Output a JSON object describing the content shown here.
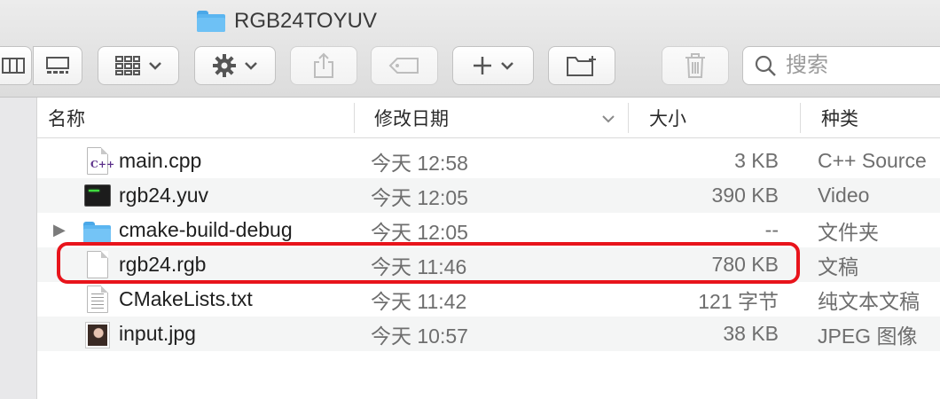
{
  "window": {
    "title": "RGB24TOYUV",
    "folder_icon": "folder-icon"
  },
  "toolbar": {
    "view_list_icon": "list-view-icon",
    "view_gallery_icon": "gallery-view-icon",
    "group_icon": "grid-group-icon",
    "action_icon": "gear-icon",
    "share_icon": "share-icon",
    "tag_icon": "tag-icon",
    "new_icon": "plus-icon",
    "new_folder_icon": "new-folder-icon",
    "trash_icon": "trash-icon",
    "chevron": "⌄"
  },
  "search": {
    "placeholder": "搜索",
    "value": ""
  },
  "columns": {
    "name": "名称",
    "date": "修改日期",
    "size": "大小",
    "kind": "种类"
  },
  "files": [
    {
      "name": "main.cpp",
      "date": "今天 12:58",
      "size": "3 KB",
      "kind": "C++ Source",
      "icon": "cpp-file-icon",
      "disclosure": ""
    },
    {
      "name": "rgb24.yuv",
      "date": "今天 12:05",
      "size": "390 KB",
      "kind": "Video",
      "icon": "terminal-file-icon",
      "disclosure": ""
    },
    {
      "name": "cmake-build-debug",
      "date": "今天 12:05",
      "size": "--",
      "kind": "文件夹",
      "icon": "folder-icon",
      "disclosure": "▶"
    },
    {
      "name": "rgb24.rgb",
      "date": "今天 11:46",
      "size": "780 KB",
      "kind": "文稿",
      "icon": "blank-document-icon",
      "disclosure": ""
    },
    {
      "name": "CMakeLists.txt",
      "date": "今天 11:42",
      "size": "121 字节",
      "kind": "纯文本文稿",
      "icon": "text-document-icon",
      "disclosure": ""
    },
    {
      "name": "input.jpg",
      "date": "今天 10:57",
      "size": "38 KB",
      "kind": "JPEG 图像",
      "icon": "image-thumbnail-icon",
      "disclosure": ""
    }
  ],
  "colors": {
    "highlight": "#e8141b",
    "folder": "#5bb5f0",
    "alt_row": "#f4f5f5"
  }
}
